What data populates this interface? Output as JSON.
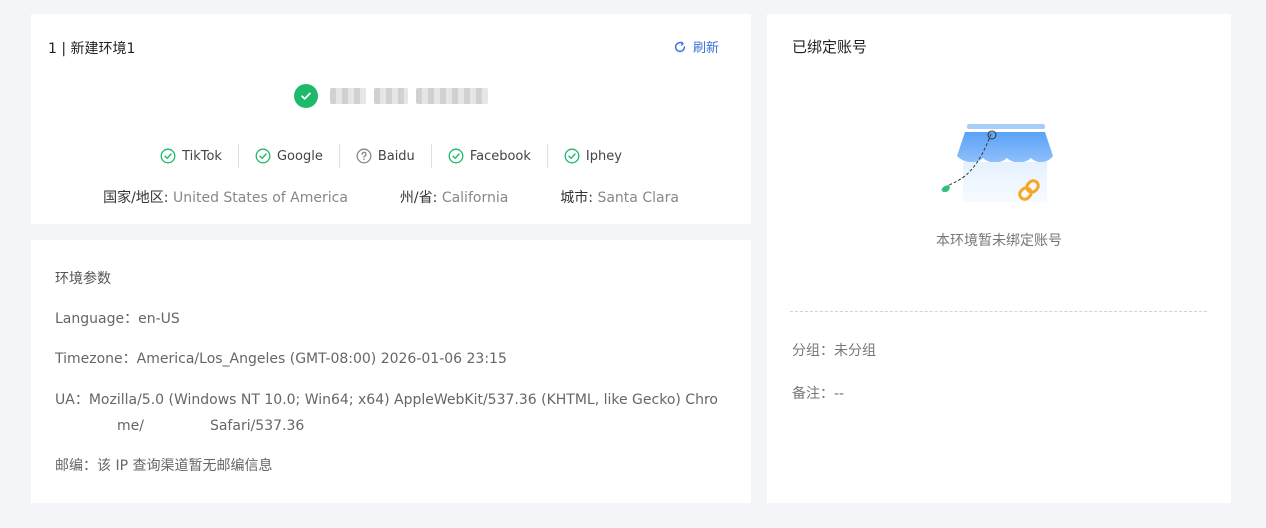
{
  "env": {
    "title": "1 | 新建环境1",
    "refresh_label": "刷新",
    "checks": [
      {
        "label": "TikTok",
        "status": "ok"
      },
      {
        "label": "Google",
        "status": "ok"
      },
      {
        "label": "Baidu",
        "status": "unknown"
      },
      {
        "label": "Facebook",
        "status": "ok"
      },
      {
        "label": "Iphey",
        "status": "ok"
      }
    ],
    "geo": {
      "country_label": "国家/地区:",
      "country_value": "United States of America",
      "state_label": "州/省:",
      "state_value": "California",
      "city_label": "城市:",
      "city_value": "Santa Clara"
    },
    "colors": {
      "ok": "#1fb96c",
      "accent": "#3b6fd8",
      "unknown": "#888888"
    }
  },
  "params": {
    "title": "环境参数",
    "language_label": "Language：",
    "language_value": "en-US",
    "timezone_label": "Timezone：",
    "timezone_value": "America/Los_Angeles (GMT-08:00) 2026-01-06 23:15",
    "ua_label": "UA：",
    "ua_line1": "Mozilla/5.0 (Windows NT 10.0; Win64; x64) AppleWebKit/537.36 (KHTML, like Gecko) Chro",
    "ua_line2a": "me/",
    "ua_line2b": "Safari/537.36",
    "zip_label": "邮编：",
    "zip_value": "该 IP 查询渠道暂无邮编信息"
  },
  "account": {
    "title": "已绑定账号",
    "empty_text": "本环境暂未绑定账号",
    "group_label": "分组：",
    "group_value": "未分组",
    "note_label": "备注：",
    "note_value": "--"
  }
}
